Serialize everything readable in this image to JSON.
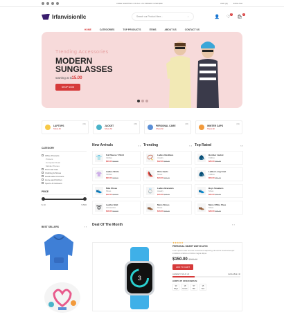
{
  "topbar": {
    "promo": "FREE SHIPPING ON ALL US ORDER OVER $99",
    "currency": "USD ($)",
    "language": "ENGLISH"
  },
  "header": {
    "logo": "Irfanvisionllc",
    "search_placeholder": "Search our Product Here..."
  },
  "nav": {
    "items": [
      "HOME",
      "CATEGORIES",
      "TOP PRODUCTS",
      "ITEMS",
      "ABOUT US",
      "CONTACT US"
    ]
  },
  "hero": {
    "kicker": "Trending Accessories",
    "title": "MODERN SUNGLASSES",
    "starting_at": "starting at $",
    "price": "15.00",
    "cta": "SHOP NOW"
  },
  "categories": [
    {
      "name": "LAPTOPS",
      "sub": "Show All",
      "count": "(03)",
      "color": "#f7c948"
    },
    {
      "name": "JACKET",
      "sub": "Show All",
      "count": "(05)",
      "color": "#4ab3c9"
    },
    {
      "name": "PERSONAL CARE",
      "sub": "Show All",
      "count": "(06)",
      "color": "#5b8fd6"
    },
    {
      "name": "WINTER CAPS",
      "sub": "Show All",
      "count": "(02)",
      "color": "#f29a3c"
    }
  ],
  "sidebar": {
    "title": "CATEGORY",
    "items": [
      {
        "label": "Office Products",
        "sub": false
      },
      {
        "label": "Printers",
        "sub": true
      },
      {
        "label": "Computer Desk",
        "sub": true
      },
      {
        "label": "Mobile Phones",
        "sub": true
      },
      {
        "label": "Personal Care",
        "sub": false
      },
      {
        "label": "Clothing & Shoes",
        "sub": false
      },
      {
        "label": "Handmade Products",
        "sub": false
      },
      {
        "label": "Home and Kitchen",
        "sub": false
      },
      {
        "label": "Sports & Outdoors",
        "sub": false
      }
    ],
    "price_title": "PRICE",
    "price_min": "$ 10",
    "price_max": "$ 500"
  },
  "columns": [
    {
      "title": "New Arrivals",
      "products": [
        {
          "name": "Full Sleeve T-Shirt",
          "cat": "Clothes",
          "price": "$20.00",
          "old": "$22.00",
          "icon": "👕"
        },
        {
          "name": "Ladies Shirts",
          "cat": "Clothes",
          "price": "$30.00",
          "old": "$38.00",
          "icon": "👚"
        },
        {
          "name": "Nike Shoes",
          "cat": "Shoes",
          "price": "$12.00",
          "old": "$15.00",
          "icon": "👟"
        },
        {
          "name": "Leather Belt",
          "cat": "Accessories",
          "price": "$18.00",
          "old": "$22.00",
          "icon": "➰"
        }
      ]
    },
    {
      "title": "Trending",
      "products": [
        {
          "name": "Ladies Necklace",
          "cat": "Jewelry",
          "price": "$12.00",
          "old": "$15.00",
          "icon": "📿"
        },
        {
          "name": "Ohio Heels",
          "cat": "Shoes",
          "price": "$40.00",
          "old": "$45.00",
          "icon": "👠"
        },
        {
          "name": "Ladies Bracelets",
          "cat": "Jewelry",
          "price": "$15.00",
          "old": "$18.00",
          "icon": "💍"
        },
        {
          "name": "Mens Shoes",
          "cat": "Shoes",
          "price": "$16.00",
          "old": "$20.00",
          "icon": "👞"
        }
      ]
    },
    {
      "title": "Top Rated",
      "products": [
        {
          "name": "Bomber Jacket",
          "cat": "Clothes",
          "price": "$35.00",
          "old": "$40.00",
          "icon": "🧥"
        },
        {
          "name": "Ladies Long Coat",
          "cat": "Clothes",
          "price": "$50.00",
          "old": "$60.00",
          "icon": "🧥"
        },
        {
          "name": "Boys Sneakers",
          "cat": "Shoes",
          "price": "$25.00",
          "old": "$32.00",
          "icon": "👟"
        },
        {
          "name": "Mens Office Shoe",
          "cat": "Shoes",
          "price": "$30.00",
          "old": "$35.00",
          "icon": "👞"
        }
      ]
    }
  ],
  "bestsellers": {
    "title": "BEST SELLERS"
  },
  "deal": {
    "title": "Deal Of The Month",
    "stars": "★★★★★",
    "name": "PERSONAL SMART WATCH A700",
    "desc": "Lorem ipsum dolor sit amet consectetur adipiscing elit sed do eiusmod tempor incididunt ut labore et dolore magna aliqua.",
    "price": "$150.00",
    "old_price": "$200.00",
    "cart": "ADD TO CART",
    "sold_label": "ALREADY SOLD: 20",
    "avail_label": "AVAILABLE: 40",
    "sold_fraction": 0.33,
    "hurry": "HURRY UP! OFFER ENDS IN:",
    "timer": [
      {
        "n": "30",
        "u": "Days"
      },
      {
        "n": "18",
        "u": "Hours"
      },
      {
        "n": "57",
        "u": "Min"
      },
      {
        "n": "15",
        "u": "Sec"
      }
    ]
  }
}
